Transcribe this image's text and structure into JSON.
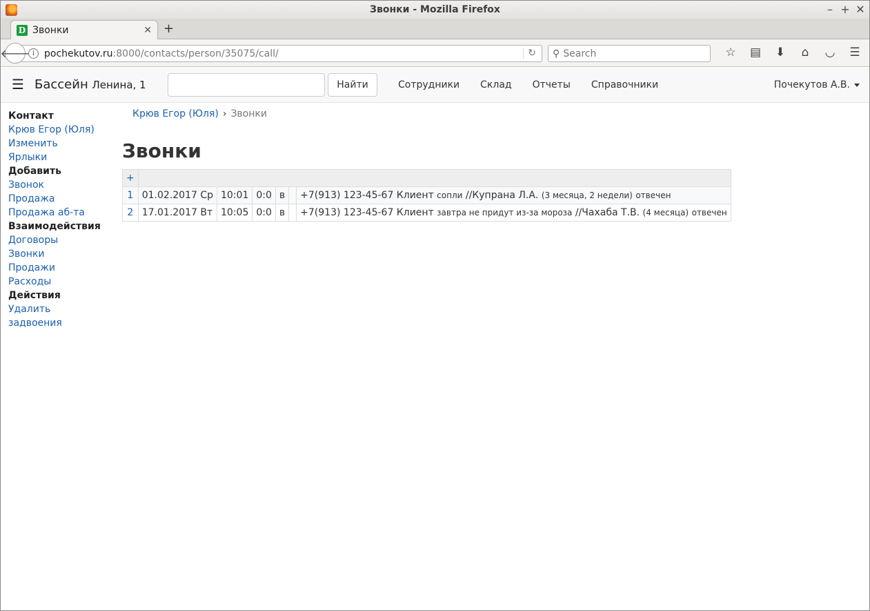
{
  "window": {
    "title": "Звонки - Mozilla Firefox"
  },
  "tabs": [
    {
      "label": "Звонки",
      "favicon_letter": "D"
    }
  ],
  "urlbar": {
    "host": "pochekutov.ru",
    "path": ":8000/contacts/person/35075/call/"
  },
  "searchbar": {
    "placeholder": "Search"
  },
  "header": {
    "brand": "Бассейн",
    "brand_sub": "Ленина, 1",
    "search_button": "Найти",
    "nav": [
      "Сотрудники",
      "Склад",
      "Отчеты",
      "Справочники"
    ],
    "user": "Почекутов А.В."
  },
  "sidebar": {
    "contact_heading": "Контакт",
    "contact_items": [
      "Крюв Егор (Юля)",
      "Изменить",
      "Ярлыки"
    ],
    "add_heading": "Добавить",
    "add_items": [
      "Звонок",
      "Продажа",
      "Продажа аб-та"
    ],
    "interactions_heading": "Взаимодействия",
    "interactions_items": [
      "Договоры",
      "Звонки",
      "Продажи",
      "Расходы"
    ],
    "actions_heading": "Действия",
    "actions_items": [
      "Удалить",
      "задвоения"
    ]
  },
  "breadcrumb": {
    "parent": "Крюв Егор (Юля)",
    "current": "Звонки"
  },
  "page_title": "Звонки",
  "calls": {
    "add_label": "+",
    "rows": [
      {
        "num": "1",
        "date": "01.02.2017 Ср",
        "time": "10:01",
        "duration": "0:0",
        "direction": "в",
        "phone": "+7(913) 123-45-67 Клиент",
        "note": "сопли",
        "author": "//Купрана Л.А.",
        "ago": "(3 месяца, 2 недели)",
        "status": "отвечен"
      },
      {
        "num": "2",
        "date": "17.01.2017 Вт",
        "time": "10:05",
        "duration": "0:0",
        "direction": "в",
        "phone": "+7(913) 123-45-67 Клиент",
        "note": "завтра не придут из-за мороза",
        "author": "//Чахаба Т.В.",
        "ago": "(4 месяца)",
        "status": "отвечен"
      }
    ]
  }
}
